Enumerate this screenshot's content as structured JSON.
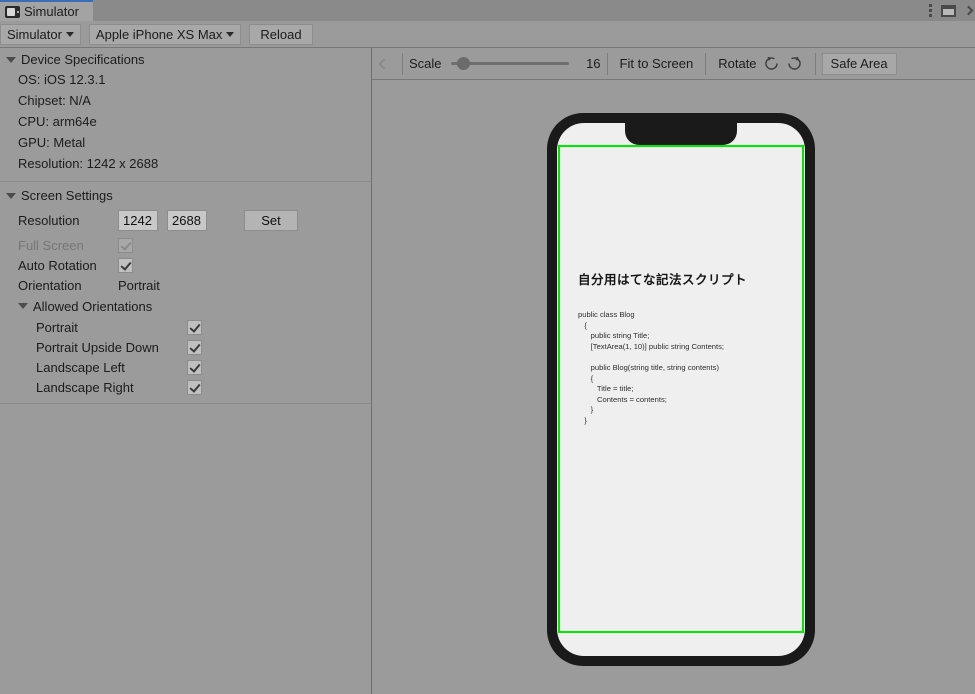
{
  "window": {
    "tab_label": "Simulator",
    "tab_icon": "simulator-device-icon",
    "menu_icon": "kebab-menu-icon",
    "panel_icon": "panel-layout-icon",
    "expand_icon": "chevron-right-icon"
  },
  "toolbar": {
    "mode_label": "Simulator",
    "device_label": "Apple iPhone XS Max",
    "reload_label": "Reload",
    "caret_icon": "chevron-down-icon"
  },
  "specs": {
    "header": "Device Specifications",
    "rows": [
      "OS: iOS 12.3.1",
      "Chipset: N/A",
      "CPU: arm64e",
      "GPU: Metal",
      "Resolution: 1242 x 2688"
    ]
  },
  "screen_settings": {
    "header": "Screen Settings",
    "resolution_label": "Resolution",
    "resolution_width": "1242",
    "resolution_height": "2688",
    "set_label": "Set",
    "full_screen_label": "Full Screen",
    "auto_rotation_label": "Auto Rotation",
    "orientation_label": "Orientation",
    "orientation_value": "Portrait",
    "allowed_header": "Allowed Orientations",
    "allowed": [
      {
        "label": "Portrait",
        "checked": true
      },
      {
        "label": "Portrait Upside Down",
        "checked": true
      },
      {
        "label": "Landscape Left",
        "checked": true
      },
      {
        "label": "Landscape Right",
        "checked": true
      }
    ]
  },
  "sim_toolbar": {
    "back_icon": "chevron-left-icon",
    "scale_label": "Scale",
    "scale_value": "16",
    "fit_label": "Fit to Screen",
    "rotate_label": "Rotate",
    "rotate_ccw_icon": "rotate-counterclockwise-icon",
    "rotate_cw_icon": "rotate-clockwise-icon",
    "safe_area_label": "Safe Area"
  },
  "device_preview": {
    "page_title": "自分用はてな記法スクリプト",
    "code": "public class Blog\n   {\n      public string Title;\n      [TextArea(1, 10)] public string Contents;\n\n      public Blog(string title, string contents)\n      {\n         Title = title;\n         Contents = contents;\n      }\n   }",
    "safe_area_color": "#00e800"
  }
}
